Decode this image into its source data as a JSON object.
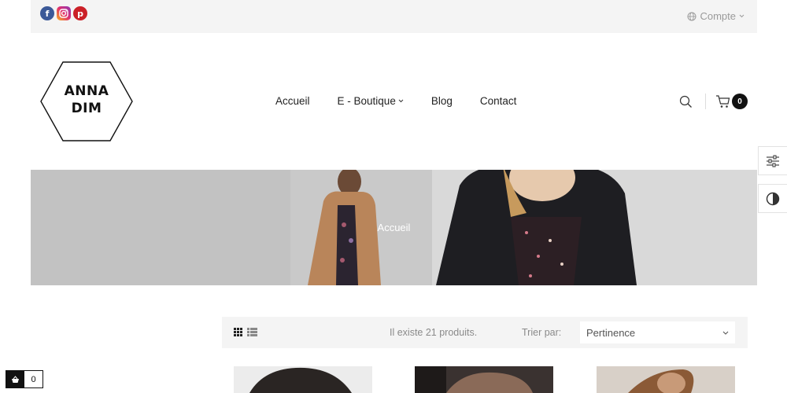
{
  "topbar": {
    "social": [
      {
        "icon": "facebook-icon",
        "glyph": "f",
        "color": "#3b5998"
      },
      {
        "icon": "instagram-icon",
        "glyph": "◎",
        "color": "#e2306c"
      },
      {
        "icon": "pinterest-icon",
        "glyph": "p",
        "color": "#cb2027"
      }
    ],
    "account_label": "Compte"
  },
  "logo": {
    "line1": "ANNA",
    "line2": "DIM"
  },
  "nav": {
    "items": [
      {
        "label": "Accueil"
      },
      {
        "label": "E - Boutique"
      },
      {
        "label": "Blog"
      },
      {
        "label": "Contact"
      }
    ]
  },
  "header": {
    "cart_count": "0"
  },
  "banner": {
    "title": "Accueil"
  },
  "toolbar": {
    "product_count_text": "Il existe 21 produits.",
    "sort_label": "Trier par:",
    "sort_value": "Pertinence"
  },
  "minicart": {
    "count": "0"
  },
  "colors": {
    "dark": "#111111",
    "muted": "#8a8a8a",
    "panel": "#f4f4f4"
  }
}
